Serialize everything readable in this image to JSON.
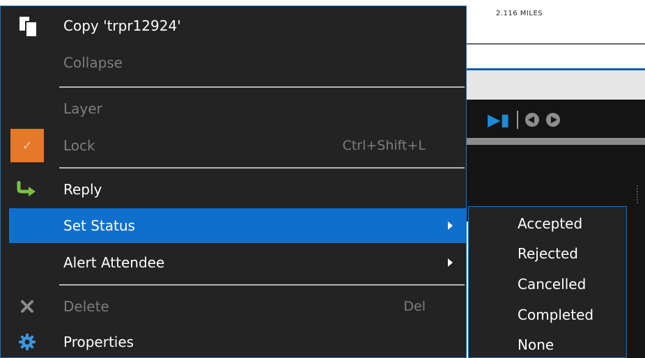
{
  "background": {
    "scale_text": "2.116 MILES"
  },
  "menu": {
    "items": [
      {
        "label": "Copy 'trpr12924'",
        "icon": "copy-icon",
        "enabled": true
      },
      {
        "label": "Collapse",
        "enabled": false
      },
      {
        "label": "Layer",
        "enabled": false
      },
      {
        "label": "Lock",
        "shortcut": "Ctrl+Shift+L",
        "icon": "checkmark-icon",
        "checked": true,
        "enabled": false
      },
      {
        "label": "Reply",
        "icon": "reply-arrow-icon",
        "enabled": true
      },
      {
        "label": "Set Status",
        "has_submenu": true,
        "highlighted": true,
        "enabled": true
      },
      {
        "label": "Alert Attendee",
        "has_submenu": true,
        "enabled": true
      },
      {
        "label": "Delete",
        "shortcut": "Del",
        "icon": "x-icon",
        "enabled": false
      },
      {
        "label": "Properties",
        "icon": "gear-icon",
        "enabled": true
      }
    ]
  },
  "submenu": {
    "parent": "Set Status",
    "items": [
      "Accepted",
      "Rejected",
      "Cancelled",
      "Completed",
      "None"
    ]
  },
  "colors": {
    "menu_background": "#232323",
    "highlight": "#0e6fcd",
    "border": "#1a75bf",
    "lock_checkbox": "#e6782a",
    "reply_icon": "#7cc142",
    "gear_icon": "#3a96dd",
    "disabled_text": "#7d7d7d"
  }
}
